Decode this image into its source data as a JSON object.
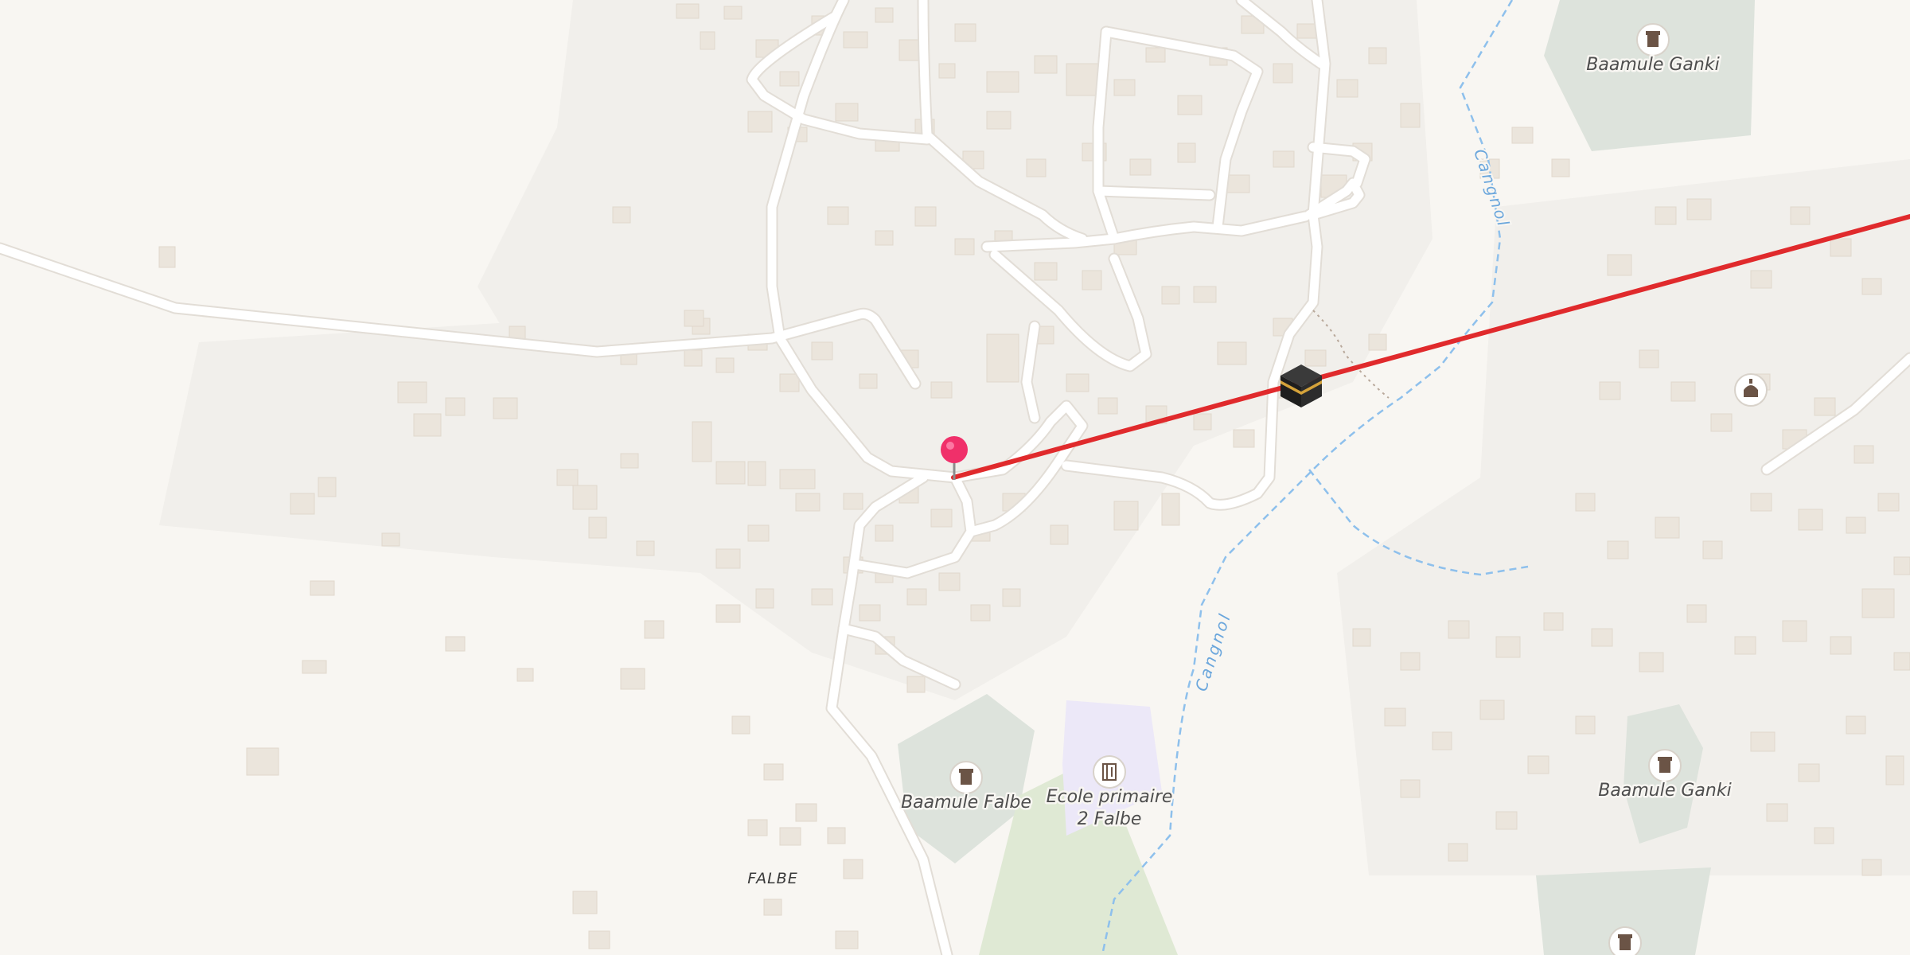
{
  "map": {
    "places": [
      {
        "id": "cem1",
        "name": "Baamule Ganki",
        "icon": "cemetery-icon"
      },
      {
        "id": "cem2",
        "name": "Baamule Falbe",
        "icon": "cemetery-icon"
      },
      {
        "id": "cem3",
        "name": "Baamule Ganki",
        "icon": "cemetery-icon"
      },
      {
        "id": "school",
        "name": "Ecole primaire",
        "name2": "2 Falbe",
        "icon": "school-icon"
      }
    ],
    "locality": "FALBE",
    "stream_name": "Cangnol",
    "colors": {
      "background": "#f8f6f2",
      "residential": "#f1efeb",
      "building": "#ebe5dc",
      "road": "#ffffff",
      "stream": "#8ec0ec",
      "cemetery": "#dde3dc",
      "school_area": "#ece8f8",
      "park": "#dfe9d4",
      "route": "#e02a2c",
      "pin": "#f0306a"
    },
    "markers": [
      {
        "id": "origin-pin",
        "icon": "map-pin-icon"
      },
      {
        "id": "kaaba",
        "icon": "kaaba-icon"
      },
      {
        "id": "mosque",
        "icon": "mosque-icon"
      }
    ]
  }
}
